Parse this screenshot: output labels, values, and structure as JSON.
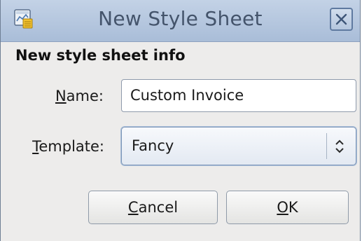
{
  "window": {
    "title": "New Style Sheet",
    "icons": {
      "app": "spreadsheet-icon",
      "close": "close-icon"
    }
  },
  "section": {
    "title": "New style sheet info"
  },
  "form": {
    "name": {
      "label_mnemonic": "N",
      "label_rest": "ame:",
      "value": "Custom Invoice"
    },
    "template": {
      "label_mnemonic": "T",
      "label_rest": "emplate:",
      "selected": "Fancy"
    }
  },
  "buttons": {
    "cancel": {
      "mnemonic": "C",
      "rest": "ancel"
    },
    "ok": {
      "mnemonic": "O",
      "rest": "K"
    }
  },
  "colors": {
    "titlebar": "#b3c5de",
    "title_text": "#44546b",
    "dialog_bg": "#edeceb"
  }
}
